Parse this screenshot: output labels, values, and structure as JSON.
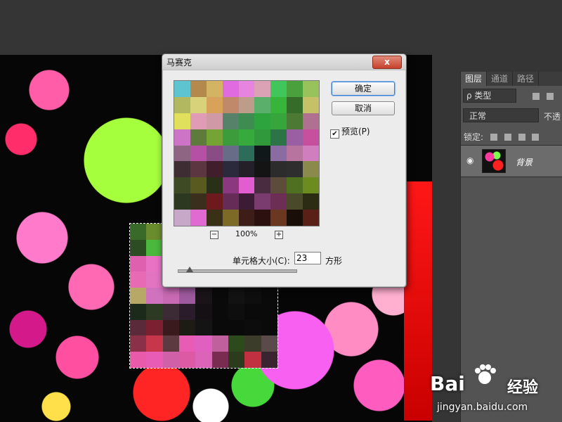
{
  "dialog": {
    "title": "马赛克",
    "close_label": "x",
    "ok_label": "确定",
    "cancel_label": "取消",
    "preview_label": "预览(P)",
    "preview_checked": true,
    "zoom_out_label": "−",
    "zoom_in_label": "+",
    "zoom_level": "100%",
    "cell_size_label": "单元格大小(C):",
    "cell_size_value": "23",
    "cell_size_unit": "方形",
    "mosaic_colors": [
      "#5ec4cf",
      "#b48a4c",
      "#d4b463",
      "#e06be0",
      "#e784dd",
      "#dba2b6",
      "#40c65a",
      "#4aa03c",
      "#9ac25c",
      "#b2b860",
      "#d8d27a",
      "#d8a25a",
      "#c08a6a",
      "#be9c8a",
      "#5ab06a",
      "#37b43a",
      "#356c2a",
      "#c6c068",
      "#e0e05c",
      "#e09cb4",
      "#cf9aa6",
      "#56826a",
      "#3e8c52",
      "#2ea43e",
      "#36a63c",
      "#4c7a34",
      "#b07090",
      "#ce74c6",
      "#5e7a3c",
      "#74a434",
      "#3c9c3c",
      "#36aa3c",
      "#30993c",
      "#2c7448",
      "#9a5ea2",
      "#c64f9e",
      "#8e6684",
      "#b650a4",
      "#8a4c84",
      "#686c86",
      "#2c6c58",
      "#10181a",
      "#8a6ca2",
      "#b6749e",
      "#d07ec0",
      "#3e2e34",
      "#5c3640",
      "#401e2c",
      "#2a2a3c",
      "#24202a",
      "#141414",
      "#2c2c2c",
      "#2e2e2e",
      "#8a8a4c",
      "#3e4a24",
      "#585a20",
      "#2a3018",
      "#8c3880",
      "#e25ed0",
      "#4a2c40",
      "#5e4c3a",
      "#4e7020",
      "#6c8c20",
      "#2c3820",
      "#3a2e1c",
      "#6c1a1e",
      "#662c58",
      "#3c1c34",
      "#7a3c6e",
      "#6c2e54",
      "#4a4a2a",
      "#2c2c14",
      "#c8a8c8",
      "#e06ad2",
      "#3a3018",
      "#7c6a26",
      "#3e1c18",
      "#2c1010",
      "#6a3820",
      "#1a0e08",
      "#5a2018"
    ]
  },
  "canvas_mosaic_colors": [
    "#3a6a2a",
    "#6a8c2c",
    "#e2d24a",
    "#4ac45c",
    "#5cbe4a",
    "#2c8c2c",
    "#36b040",
    "#2c5a2a",
    "#1c2a1c",
    "#2c4c24",
    "#4ab83c",
    "#3cb448",
    "#3c8c3c",
    "#2c6c2c",
    "#2a3a1c",
    "#1a1a1a",
    "#3a2c2c",
    "#1c1c1c",
    "#e060b0",
    "#e872c4",
    "#d064c0",
    "#c06ab0",
    "#3a1e2a",
    "#101010",
    "#1a1a1a",
    "#141414",
    "#0e0e0e",
    "#e86ab4",
    "#e274c2",
    "#d06ec0",
    "#b060a8",
    "#2a1c24",
    "#0c0c0c",
    "#161616",
    "#101010",
    "#0c0c0c",
    "#b8a868",
    "#d072be",
    "#c86ab4",
    "#9e5a9e",
    "#1a1418",
    "#0a0a0a",
    "#121212",
    "#0e0e0e",
    "#0a0a0a",
    "#1c2a1c",
    "#2c3a24",
    "#3c2a34",
    "#2a1c2a",
    "#141014",
    "#0a0a0a",
    "#0e0e0e",
    "#0a0a0a",
    "#0a0a0a",
    "#5a2a3a",
    "#7a2030",
    "#3a1a1c",
    "#1c1c14",
    "#141414",
    "#0a0a0a",
    "#0a0a0a",
    "#0c0c0c",
    "#0a0a0a",
    "#8a3048",
    "#c8364c",
    "#5c3a40",
    "#e85cb6",
    "#e060c0",
    "#c0609c",
    "#2c4a1c",
    "#3c3c2a",
    "#5a4a4a",
    "#ea5aaa",
    "#e85cb6",
    "#d060a8",
    "#dc5aa4",
    "#dc64b8",
    "#7a2c50",
    "#2a3c1c",
    "#c03040",
    "#3a2430"
  ],
  "panel": {
    "tabs": [
      "图层",
      "通道",
      "路径"
    ],
    "filter_label": "ρ 类型",
    "blend_mode": "正常",
    "opacity_label": "不透",
    "lock_label": "锁定:",
    "layer_name": "背景",
    "eye_icon_glyph": "◉"
  },
  "watermark": {
    "brand_left": "Bai",
    "brand_right": "经验",
    "url": "jingyan.baidu.com"
  }
}
